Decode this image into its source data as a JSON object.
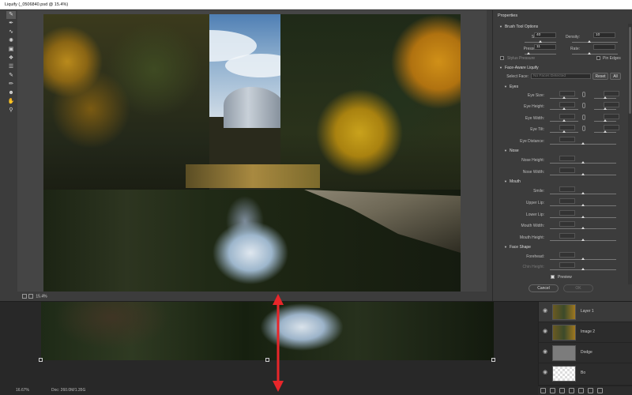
{
  "dialog": {
    "title": "Liquify (_0506840.psd @ 15.4%)",
    "zoom": "15.4%"
  },
  "tools": [
    "forward-warp",
    "reconstruct",
    "smooth",
    "twirl",
    "pucker",
    "bloat",
    "push-left",
    "freeze-mask",
    "thaw-mask",
    "face",
    "hand",
    "zoom"
  ],
  "properties": {
    "title": "Properties",
    "brush_section": "Brush Tool Options",
    "size_label": "Size:",
    "size_value": "40",
    "density_label": "Density:",
    "density_value": "10",
    "pressure_label": "Pressure:",
    "pressure_value": "11",
    "rate_label": "Rate:",
    "rate_value": "",
    "stylus_label": "Stylus Pressure",
    "pin_label": "Pin Edges",
    "face_section": "Face-Aware Liquify",
    "select_face_label": "Select Face:",
    "select_face_value": "No Faces Detected",
    "reset_label": "Reset",
    "all_label": "All",
    "eyes_section": "Eyes",
    "eye_size": "Eye Size:",
    "eye_height": "Eye Height:",
    "eye_width": "Eye Width:",
    "eye_tilt": "Eye Tilt:",
    "eye_distance": "Eye Distance:",
    "nose_section": "Nose",
    "nose_height": "Nose Height:",
    "nose_width": "Nose Width:",
    "mouth_section": "Mouth",
    "smile": "Smile:",
    "upper_lip": "Upper Lip:",
    "lower_lip": "Lower Lip:",
    "mouth_width": "Mouth Width:",
    "mouth_height": "Mouth Height:",
    "face_shape_section": "Face Shape",
    "forehead": "Forehead:",
    "chin_height": "Chin Height:",
    "preview_label": "Preview",
    "cancel_label": "Cancel",
    "ok_label": "OK"
  },
  "layers": [
    {
      "name": "Layer 1",
      "selected": true
    },
    {
      "name": "Image 2",
      "selected": false
    },
    {
      "name": "Dodge",
      "selected": false
    },
    {
      "name": "Bo",
      "selected": false
    }
  ],
  "status": {
    "zoom": "16.67%",
    "doc": "Doc: 260.0M/1.35G"
  },
  "colors": {
    "arrow": "#e8262a"
  }
}
